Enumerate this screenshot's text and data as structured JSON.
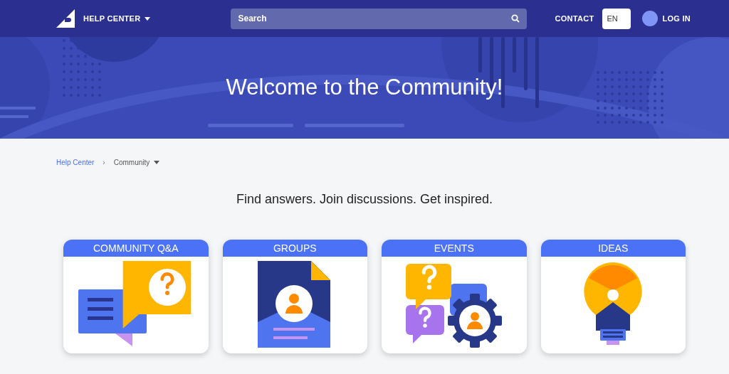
{
  "header": {
    "brand": "HELP CENTER",
    "search": {
      "placeholder": "Search"
    },
    "contact": "CONTACT",
    "language": "EN",
    "login": "LOG IN"
  },
  "hero": {
    "title": "Welcome to the Community!"
  },
  "breadcrumb_separator": "›",
  "breadcrumb": [
    {
      "label": "Help Center",
      "kind": "link"
    },
    {
      "label": "Community",
      "kind": "current"
    }
  ],
  "tagline": "Find answers. Join discussions. Get inspired.",
  "cards": [
    {
      "title": "COMMUNITY Q&A",
      "kind": "qa"
    },
    {
      "title": "GROUPS",
      "kind": "groups"
    },
    {
      "title": "EVENTS",
      "kind": "events"
    },
    {
      "title": "IDEAS",
      "kind": "ideas"
    }
  ]
}
